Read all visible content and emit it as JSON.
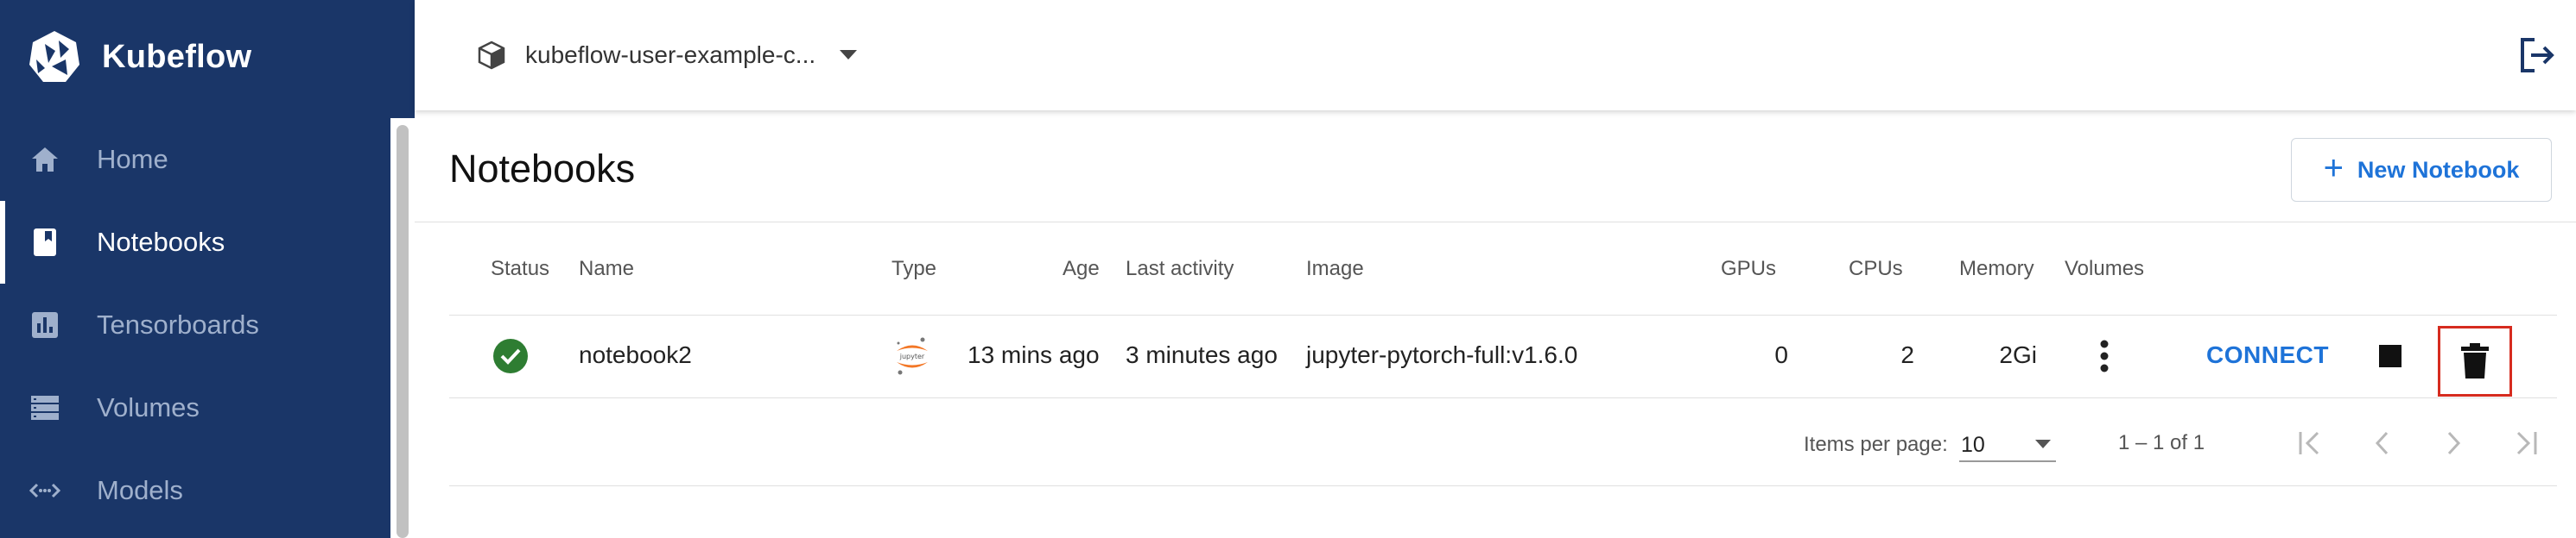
{
  "brand": {
    "name": "Kubeflow"
  },
  "sidebar": {
    "items": [
      {
        "label": "Home",
        "icon": "home-icon"
      },
      {
        "label": "Notebooks",
        "icon": "notebook-icon",
        "active": true
      },
      {
        "label": "Tensorboards",
        "icon": "tensorboard-icon"
      },
      {
        "label": "Volumes",
        "icon": "volumes-icon"
      },
      {
        "label": "Models",
        "icon": "models-icon"
      }
    ]
  },
  "topbar": {
    "namespace": "kubeflow-user-example-c...",
    "namespace_icon": "cube-icon",
    "logout_icon": "logout-icon"
  },
  "page": {
    "title": "Notebooks",
    "new_button": "New Notebook"
  },
  "table": {
    "columns": [
      "Status",
      "Name",
      "Type",
      "Age",
      "Last activity",
      "Image",
      "GPUs",
      "CPUs",
      "Memory",
      "Volumes"
    ],
    "rows": [
      {
        "status": "ready",
        "name": "notebook2",
        "type": "jupyter",
        "age": "13 mins ago",
        "last_activity": "3 minutes ago",
        "image": "jupyter-pytorch-full:v1.6.0",
        "gpus": "0",
        "cpus": "2",
        "memory": "2Gi",
        "connect": "CONNECT"
      }
    ]
  },
  "paginator": {
    "items_per_page_label": "Items per page:",
    "items_per_page": "10",
    "range": "1 – 1 of 1"
  },
  "colors": {
    "sidebar_bg": "#1a3668",
    "accent": "#1e73d8",
    "status_ok": "#2e7d32",
    "delete_highlight": "#d62b1f"
  }
}
